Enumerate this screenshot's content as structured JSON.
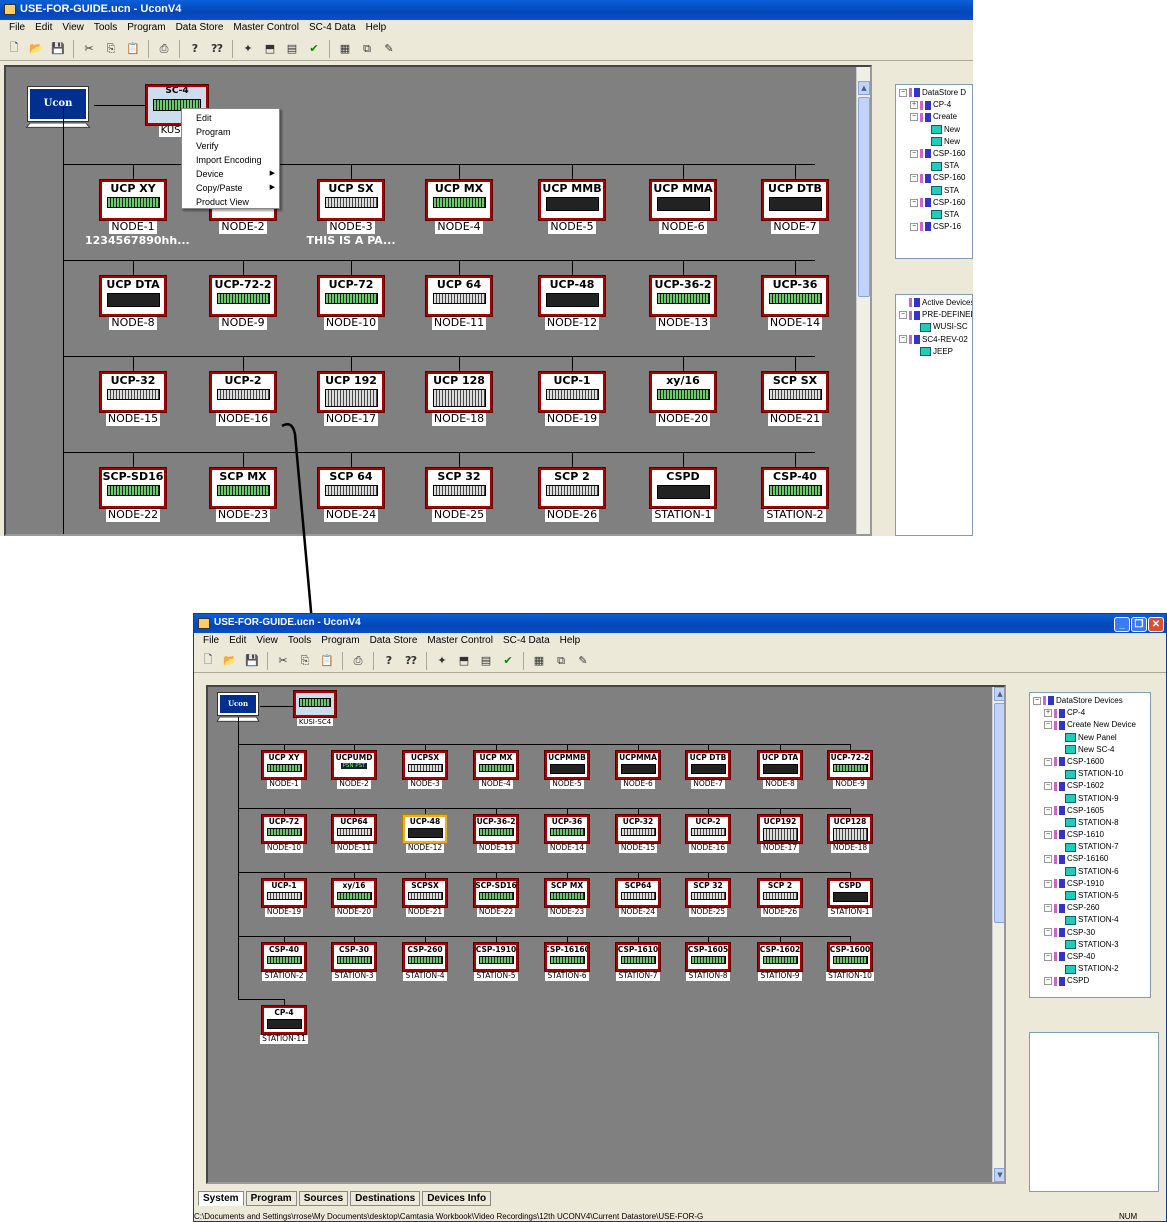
{
  "window_title": "USE-FOR-GUIDE.ucn - UconV4",
  "menu": [
    "File",
    "Edit",
    "View",
    "Tools",
    "Program",
    "Data Store",
    "Master Control",
    "SC-4 Data",
    "Help"
  ],
  "toolbar_icons": [
    "new-icon",
    "open-icon",
    "save-icon",
    "cut-icon",
    "copy-icon",
    "paste-icon",
    "print-icon",
    "help-icon",
    "context-help-icon",
    "wizard-icon",
    "bus-icon",
    "parameter-icon",
    "verify-icon",
    "palette-icon",
    "window-icon",
    "edit-icon"
  ],
  "pc_label": "Ucon",
  "top": {
    "controller": {
      "label": "SC-4",
      "name": "KUSI-S"
    },
    "context_menu": [
      {
        "label": "Edit"
      },
      {
        "label": "Program"
      },
      {
        "label": "Verify"
      },
      {
        "label": "Import Encoding"
      },
      {
        "label": "Device",
        "sub": true
      },
      {
        "label": "Copy/Paste",
        "sub": true
      },
      {
        "label": "Product View"
      }
    ],
    "devices": [
      {
        "label": "UCP XY",
        "name": "NODE-1",
        "sub": "1234567890hh..."
      },
      {
        "label": "",
        "name": "NODE-2"
      },
      {
        "label": "UCP  SX",
        "name": "NODE-3",
        "sub": "THIS IS A PA..."
      },
      {
        "label": "UCP MX",
        "name": "NODE-4"
      },
      {
        "label": "UCP MMB",
        "name": "NODE-5"
      },
      {
        "label": "UCP MMA",
        "name": "NODE-6"
      },
      {
        "label": "UCP  DTB",
        "name": "NODE-7"
      },
      {
        "label": "UCP  DTA",
        "name": "NODE-8"
      },
      {
        "label": "UCP-72-2",
        "name": "NODE-9"
      },
      {
        "label": "UCP-72",
        "name": "NODE-10"
      },
      {
        "label": "UCP 64",
        "name": "NODE-11"
      },
      {
        "label": "UCP-48",
        "name": "NODE-12"
      },
      {
        "label": "UCP-36-2",
        "name": "NODE-13"
      },
      {
        "label": "UCP-36",
        "name": "NODE-14"
      },
      {
        "label": "UCP-32",
        "name": "NODE-15"
      },
      {
        "label": "UCP-2",
        "name": "NODE-16"
      },
      {
        "label": "UCP 192",
        "name": "NODE-17"
      },
      {
        "label": "UCP 128",
        "name": "NODE-18"
      },
      {
        "label": "UCP-1",
        "name": "NODE-19"
      },
      {
        "label": "xy/16",
        "name": "NODE-20"
      },
      {
        "label": "SCP  SX",
        "name": "NODE-21"
      },
      {
        "label": "SCP-SD16",
        "name": "NODE-22"
      },
      {
        "label": "SCP MX",
        "name": "NODE-23"
      },
      {
        "label": "SCP 64",
        "name": "NODE-24"
      },
      {
        "label": "SCP 32",
        "name": "NODE-25"
      },
      {
        "label": "SCP  2",
        "name": "NODE-26"
      },
      {
        "label": "CSPD",
        "name": "STATION-1"
      },
      {
        "label": "CSP-40",
        "name": "STATION-2"
      }
    ],
    "tree": [
      {
        "pm": "-",
        "icon": "net",
        "text": "DataStore D",
        "lvl": 0
      },
      {
        "pm": "+",
        "icon": "net",
        "text": "CP-4",
        "lvl": 1
      },
      {
        "pm": "-",
        "icon": "net",
        "text": "Create",
        "lvl": 1
      },
      {
        "pm": "",
        "icon": "st",
        "text": "New",
        "lvl": 2
      },
      {
        "pm": "",
        "icon": "st",
        "text": "New",
        "lvl": 2
      },
      {
        "pm": "-",
        "icon": "net",
        "text": "CSP-160",
        "lvl": 1
      },
      {
        "pm": "",
        "icon": "st",
        "text": "STA",
        "lvl": 2
      },
      {
        "pm": "-",
        "icon": "net",
        "text": "CSP-160",
        "lvl": 1
      },
      {
        "pm": "",
        "icon": "st",
        "text": "STA",
        "lvl": 2
      },
      {
        "pm": "-",
        "icon": "net",
        "text": "CSP-160",
        "lvl": 1
      },
      {
        "pm": "",
        "icon": "st",
        "text": "STA",
        "lvl": 2
      },
      {
        "pm": "-",
        "icon": "net",
        "text": "CSP-16",
        "lvl": 1
      }
    ],
    "active": [
      {
        "pm": "",
        "icon": "net",
        "text": "Active Devices or",
        "lvl": 0
      },
      {
        "pm": "-",
        "icon": "net",
        "text": "PRE-DEFINED",
        "lvl": 0
      },
      {
        "pm": "",
        "icon": "st",
        "text": "WUSI-SC",
        "lvl": 1
      },
      {
        "pm": "-",
        "icon": "net",
        "text": "SC4-REV-02",
        "lvl": 0
      },
      {
        "pm": "",
        "icon": "st",
        "text": "JEEP",
        "lvl": 1
      }
    ]
  },
  "bottom": {
    "controller": {
      "name": "KUSI-SC4"
    },
    "devices": [
      {
        "label": "UCP XY",
        "name": "NODE-1"
      },
      {
        "label": "UCPUMD",
        "name": "NODE-2",
        "inner": "PSN  PST"
      },
      {
        "label": "UCPSX",
        "name": "NODE-3"
      },
      {
        "label": "UCP MX",
        "name": "NODE-4"
      },
      {
        "label": "UCPMMB",
        "name": "NODE-5"
      },
      {
        "label": "UCPMMA",
        "name": "NODE-6"
      },
      {
        "label": "UCP DTB",
        "name": "NODE-7"
      },
      {
        "label": "UCP DTA",
        "name": "NODE-8"
      },
      {
        "label": "UCP-72-2",
        "name": "NODE-9"
      },
      {
        "label": "UCP-72",
        "name": "NODE-10"
      },
      {
        "label": "UCP64",
        "name": "NODE-11"
      },
      {
        "label": "UCP-48",
        "name": "NODE-12"
      },
      {
        "label": "UCP-36-2",
        "name": "NODE-13"
      },
      {
        "label": "UCP-36",
        "name": "NODE-14"
      },
      {
        "label": "UCP-32",
        "name": "NODE-15"
      },
      {
        "label": "UCP-2",
        "name": "NODE-16"
      },
      {
        "label": "UCP192",
        "name": "NODE-17"
      },
      {
        "label": "UCP128",
        "name": "NODE-18"
      },
      {
        "label": "UCP-1",
        "name": "NODE-19"
      },
      {
        "label": "xy/16",
        "name": "NODE-20"
      },
      {
        "label": "SCPSX",
        "name": "NODE-21"
      },
      {
        "label": "SCP-SD16",
        "name": "NODE-22"
      },
      {
        "label": "SCP MX",
        "name": "NODE-23"
      },
      {
        "label": "SCP64",
        "name": "NODE-24"
      },
      {
        "label": "SCP 32",
        "name": "NODE-25"
      },
      {
        "label": "SCP 2",
        "name": "NODE-26"
      },
      {
        "label": "CSPD",
        "name": "STATION-1"
      },
      {
        "label": "CSP-40",
        "name": "STATION-2"
      },
      {
        "label": "CSP-30",
        "name": "STATION-3"
      },
      {
        "label": "CSP-260",
        "name": "STATION-4"
      },
      {
        "label": "CSP-1910",
        "name": "STATION-5"
      },
      {
        "label": "CSP-16160",
        "name": "STATION-6"
      },
      {
        "label": "CSP-1610",
        "name": "STATION-7"
      },
      {
        "label": "CSP-1605",
        "name": "STATION-8"
      },
      {
        "label": "CSP-1602",
        "name": "STATION-9"
      },
      {
        "label": "CSP-1600",
        "name": "STATION-10"
      },
      {
        "label": "CP-4",
        "name": "STATION-11"
      }
    ],
    "tree": [
      {
        "pm": "-",
        "icon": "net",
        "text": "DataStore Devices",
        "lvl": 0
      },
      {
        "pm": "+",
        "icon": "net",
        "text": "CP-4",
        "lvl": 1
      },
      {
        "pm": "-",
        "icon": "net",
        "text": "Create New Device",
        "lvl": 1
      },
      {
        "pm": "",
        "icon": "st",
        "text": "New Panel",
        "lvl": 2
      },
      {
        "pm": "",
        "icon": "st",
        "text": "New SC-4",
        "lvl": 2
      },
      {
        "pm": "-",
        "icon": "net",
        "text": "CSP-1600",
        "lvl": 1
      },
      {
        "pm": "",
        "icon": "st",
        "text": "STATION-10",
        "lvl": 2
      },
      {
        "pm": "-",
        "icon": "net",
        "text": "CSP-1602",
        "lvl": 1
      },
      {
        "pm": "",
        "icon": "st",
        "text": "STATION-9",
        "lvl": 2
      },
      {
        "pm": "-",
        "icon": "net",
        "text": "CSP-1605",
        "lvl": 1
      },
      {
        "pm": "",
        "icon": "st",
        "text": "STATION-8",
        "lvl": 2
      },
      {
        "pm": "-",
        "icon": "net",
        "text": "CSP-1610",
        "lvl": 1
      },
      {
        "pm": "",
        "icon": "st",
        "text": "STATION-7",
        "lvl": 2
      },
      {
        "pm": "-",
        "icon": "net",
        "text": "CSP-16160",
        "lvl": 1
      },
      {
        "pm": "",
        "icon": "st",
        "text": "STATION-6",
        "lvl": 2
      },
      {
        "pm": "-",
        "icon": "net",
        "text": "CSP-1910",
        "lvl": 1
      },
      {
        "pm": "",
        "icon": "st",
        "text": "STATION-5",
        "lvl": 2
      },
      {
        "pm": "-",
        "icon": "net",
        "text": "CSP-260",
        "lvl": 1
      },
      {
        "pm": "",
        "icon": "st",
        "text": "STATION-4",
        "lvl": 2
      },
      {
        "pm": "-",
        "icon": "net",
        "text": "CSP-30",
        "lvl": 1
      },
      {
        "pm": "",
        "icon": "st",
        "text": "STATION-3",
        "lvl": 2
      },
      {
        "pm": "-",
        "icon": "net",
        "text": "CSP-40",
        "lvl": 1
      },
      {
        "pm": "",
        "icon": "st",
        "text": "STATION-2",
        "lvl": 2
      },
      {
        "pm": "-",
        "icon": "net",
        "text": "CSPD",
        "lvl": 1
      }
    ],
    "tabs": [
      "System",
      "Program",
      "Sources",
      "Destinations",
      "Devices Info"
    ],
    "status_path": "C:\\Documents and Settings\\rrose\\My Documents\\desktop\\Camtasia Workbook\\Video Recordings\\12th UCONV4\\Current Datastore\\USE-FOR-G",
    "status_num": "NUM",
    "win_buttons": [
      "_",
      "❐",
      "✕"
    ]
  }
}
